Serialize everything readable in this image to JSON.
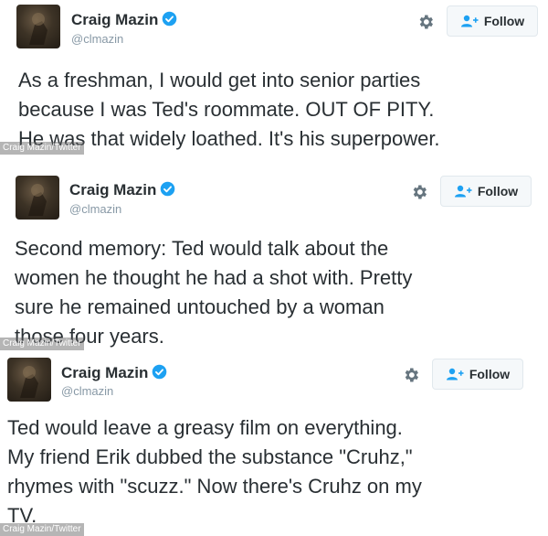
{
  "tweets": [
    {
      "name": "Craig Mazin",
      "handle": "@clmazin",
      "follow_label": "Follow",
      "lines": [
        "As a freshman, I would get into senior parties",
        "because I was Ted's roommate. OUT OF PITY.",
        "He was that widely loathed. It's his superpower."
      ],
      "credit": "Craig Mazin/Twitter"
    },
    {
      "name": "Craig Mazin",
      "handle": "@clmazin",
      "follow_label": "Follow",
      "lines": [
        "Second memory: Ted would talk about the",
        "women he thought he had a shot with. Pretty",
        "sure he remained untouched by a woman",
        "those four years."
      ],
      "credit": "Craig Mazin/Twitter"
    },
    {
      "name": "Craig Mazin",
      "handle": "@clmazin",
      "follow_label": "Follow",
      "lines": [
        "Ted would leave a greasy film on everything.",
        "My friend Erik dubbed the substance \"Cruhz,\"",
        "rhymes with \"scuzz.\" Now there's Cruhz on my",
        "TV."
      ],
      "credit": "Craig Mazin/Twitter"
    }
  ],
  "colors": {
    "text": "#292f33",
    "handle": "#8899a6",
    "verified": "#1da1f2",
    "follow_border": "#e1e8ed",
    "follow_bg": "#f5f8fa"
  },
  "icons": {
    "verified": "verified-badge-icon",
    "settings": "gear-icon",
    "follow": "person-add-icon"
  }
}
